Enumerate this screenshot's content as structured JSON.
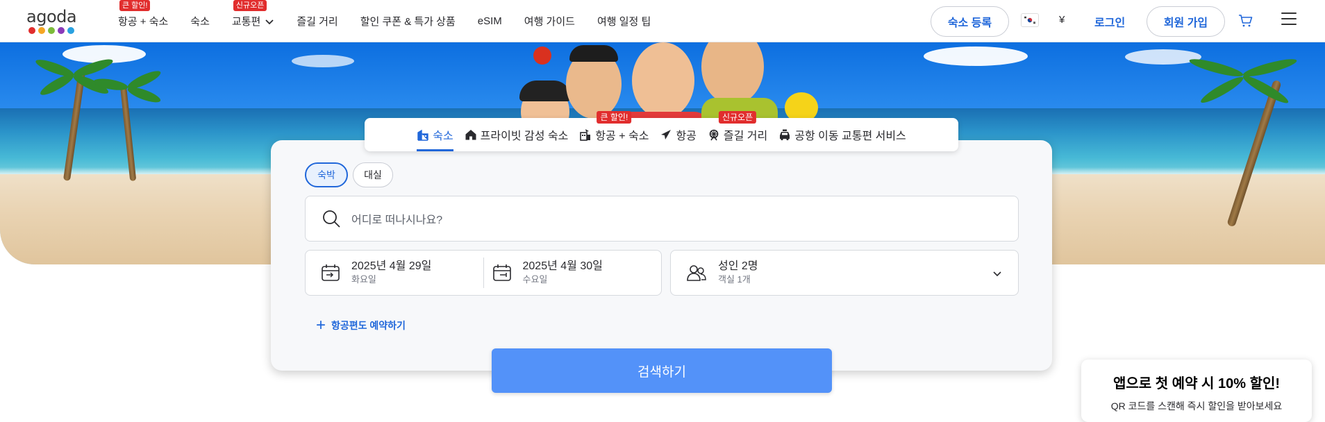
{
  "logo": {
    "text": "agoda",
    "dot_colors": [
      "#e12d2d",
      "#f5a623",
      "#7cbb3a",
      "#8a3ab9",
      "#2aa1e0"
    ]
  },
  "nav": {
    "items": [
      {
        "label": "항공 + 숙소",
        "badge": "큰 할인!"
      },
      {
        "label": "숙소"
      },
      {
        "label": "교통편",
        "badge": "신규오픈",
        "dropdown": true
      },
      {
        "label": "즐길 거리"
      },
      {
        "label": "할인 쿠폰 & 특가 상품"
      },
      {
        "label": "eSIM"
      },
      {
        "label": "여행 가이드"
      },
      {
        "label": "여행 일정 팁"
      }
    ]
  },
  "header_right": {
    "list_property": "숙소 등록",
    "currency": "¥",
    "login": "로그인",
    "signup": "회원 가입"
  },
  "tabs": [
    {
      "label": "숙소",
      "icon": "hotel-icon",
      "active": true
    },
    {
      "label": "프라이빗 감성 숙소",
      "icon": "home-icon"
    },
    {
      "label": "항공 + 숙소",
      "icon": "flight-hotel-icon",
      "badge": "큰 할인!"
    },
    {
      "label": "항공",
      "icon": "plane-icon"
    },
    {
      "label": "즐길 거리",
      "icon": "ferris-wheel-icon",
      "badge": "신규오픈"
    },
    {
      "label": "공항 이동 교통편 서비스",
      "icon": "car-icon"
    }
  ],
  "search": {
    "stay_type": {
      "overnight": "숙박",
      "day_use": "대실"
    },
    "destination_placeholder": "어디로 떠나시나요?",
    "checkin": {
      "date": "2025년 4월 29일",
      "day": "화요일"
    },
    "checkout": {
      "date": "2025년 4월 30일",
      "day": "수요일"
    },
    "guests": {
      "main": "성인 2명",
      "sub": "객실 1개"
    },
    "add_flight": "항공편도 예약하기",
    "submit": "검색하기"
  },
  "promo": {
    "title": "앱으로 첫 예약 시 10% 할인!",
    "subtitle": "QR 코드를 스캔해 즉시 할인을 받아보세요"
  },
  "colors": {
    "accent": "#2067da",
    "search_button": "#5392f9",
    "badge_red": "#e12d2d"
  }
}
